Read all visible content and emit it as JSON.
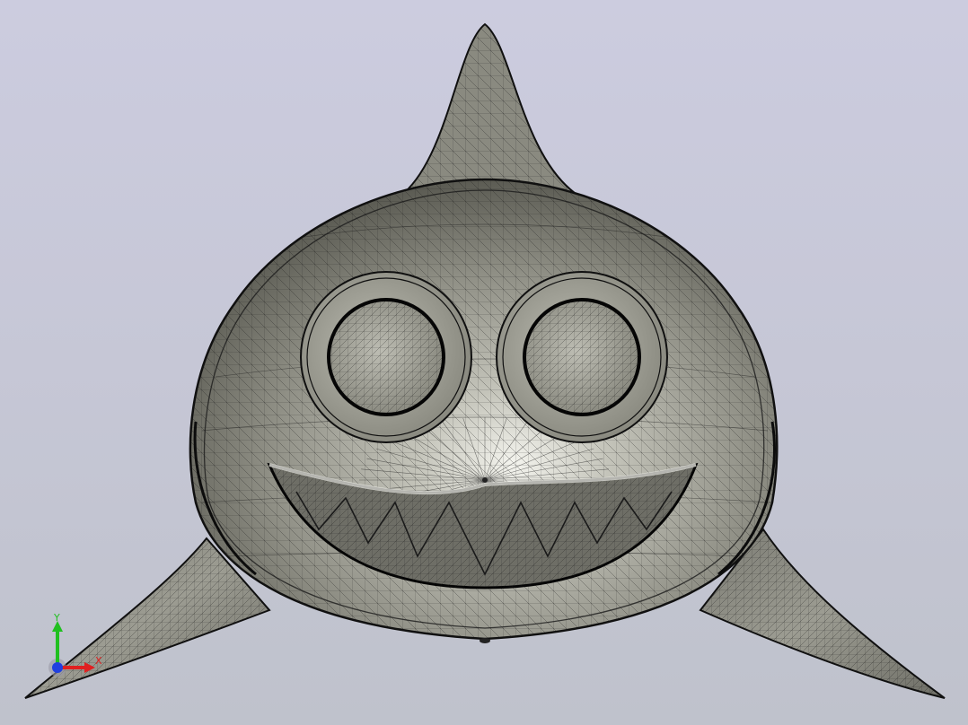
{
  "viewport": {
    "background_top": "#ccccdf",
    "background_bottom": "#bfc2cc",
    "model_color": "#8c8c82",
    "mesh_color": "#1a1a1a"
  },
  "triad": {
    "x_label": "X",
    "y_label": "Y",
    "x_color": "#e02020",
    "y_color": "#20c020",
    "z_color": "#2040e0"
  }
}
